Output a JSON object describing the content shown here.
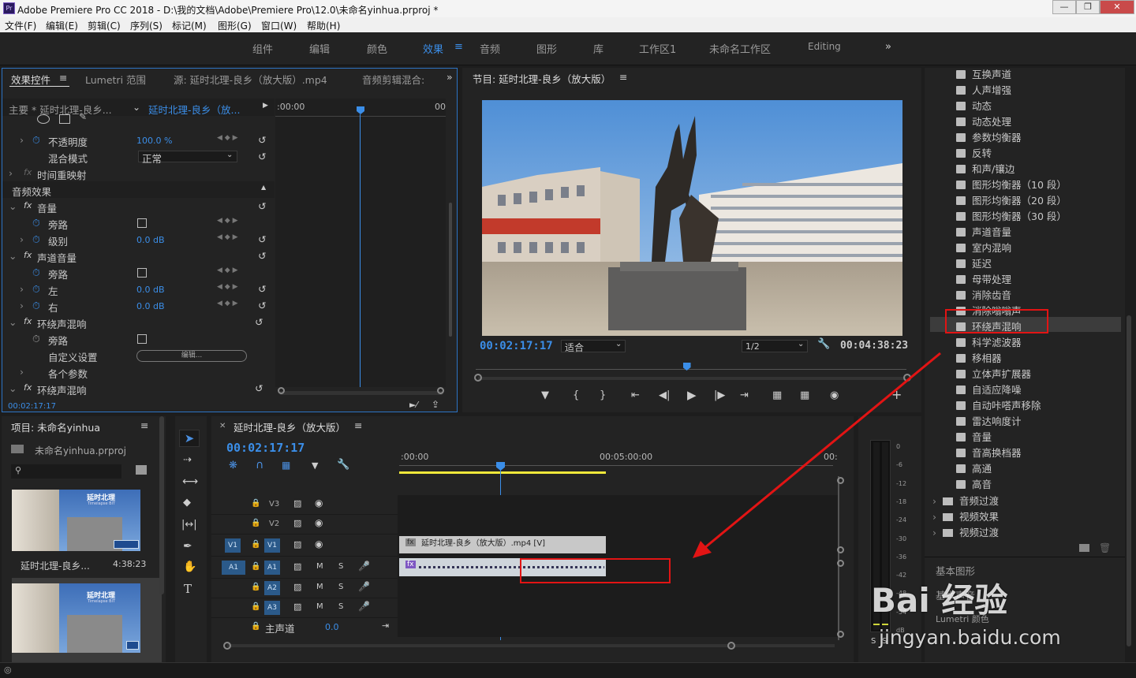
{
  "window": {
    "title": "Adobe Premiere Pro CC 2018 - D:\\我的文档\\Adobe\\Premiere Pro\\12.0\\未命名yinhua.prproj *",
    "app_badge": "Pr"
  },
  "menu": [
    "文件(F)",
    "编辑(E)",
    "剪辑(C)",
    "序列(S)",
    "标记(M)",
    "图形(G)",
    "窗口(W)",
    "帮助(H)"
  ],
  "workspaces": [
    "组件",
    "编辑",
    "颜色",
    "效果",
    "音频",
    "图形",
    "库",
    "工作区1",
    "未命名工作区",
    "Editing"
  ],
  "workspace_active": "效果",
  "effect_controls": {
    "tabs": [
      "效果控件",
      "Lumetri 范围",
      "源: 延时北理-良乡（放大版）.mp4",
      "音频剪辑混合:"
    ],
    "master_label": "主要 * 延时北理-良乡...",
    "clip_label": "延时北理-良乡（放...",
    "ruler_start": ":00:00",
    "ruler_end": "00",
    "rows": {
      "opacity": "不透明度",
      "opacity_val": "100.0 %",
      "blend": "混合模式",
      "blend_val": "正常",
      "time_remap": "时间重映射",
      "audio_fx": "音频效果",
      "volume": "音量",
      "bypass": "旁路",
      "level": "级别",
      "level_val": "0.0 dB",
      "channel_volume": "声道音量",
      "left": "左",
      "left_val": "0.0 dB",
      "right": "右",
      "right_val": "0.0 dB",
      "surround": "环绕声混响",
      "custom": "自定义设置",
      "edit_btn": "编辑...",
      "params": "各个参数",
      "surround2": "环绕声混响"
    },
    "timecode": "00:02:17:17"
  },
  "program": {
    "title": "节目: 延时北理-良乡（放大版）",
    "timecode": "00:02:17:17",
    "fit": "适合",
    "resolution": "1/2",
    "duration": "00:04:38:23",
    "playhead_fraction": 0.49
  },
  "effects_panel": {
    "items": [
      "互换声道",
      "人声增强",
      "动态",
      "动态处理",
      "参数均衡器",
      "反转",
      "和声/镶边",
      "图形均衡器（10 段）",
      "图形均衡器（20 段）",
      "图形均衡器（30 段）",
      "声道音量",
      "室内混响",
      "延迟",
      "母带处理",
      "消除齿音",
      "消除嗡嗡声",
      "环绕声混响",
      "科学滤波器",
      "移相器",
      "立体声扩展器",
      "自适应降噪",
      "自动咔嗒声移除",
      "雷达响度计",
      "音量",
      "音高换档器",
      "高通",
      "高音"
    ],
    "selected": "环绕声混响",
    "folders": [
      "音频过渡",
      "视频效果",
      "视频过渡"
    ],
    "below": [
      "基本图形",
      "基本声音",
      "Lumetri 颜色"
    ]
  },
  "project": {
    "title": "项目: 未命名yinhua",
    "file": "未命名yinhua.prproj",
    "clip_name": "延时北理-良乡...",
    "clip_duration": "4:38:23",
    "thumb_text": "延时北理",
    "thumb_sub": "Timelapse BIT"
  },
  "timeline": {
    "title": "延时北理-良乡（放大版）",
    "timecode": "00:02:17:17",
    "ruler": [
      ":00:00",
      "00:05:00:00",
      "00:"
    ],
    "tracks": [
      "V3",
      "V2",
      "V1",
      "A1",
      "A2",
      "A3"
    ],
    "clip_label": "延时北理-良乡（放大版）.mp4 [V]",
    "master": "主声道",
    "master_val": "0.0",
    "playhead_fraction": 0.49
  },
  "meter": {
    "ticks": [
      "0",
      "-6",
      "-12",
      "-18",
      "-24",
      "-30",
      "-36",
      "-42",
      "-48",
      "-54",
      "dB"
    ],
    "solo_labels": [
      "S",
      "S"
    ]
  },
  "watermark": {
    "text": "Bai 经验",
    "url": "jingyan.baidu.com"
  },
  "colors": {
    "accent": "#3b8ee8",
    "highlight": "#e21414",
    "panel": "#232323"
  }
}
